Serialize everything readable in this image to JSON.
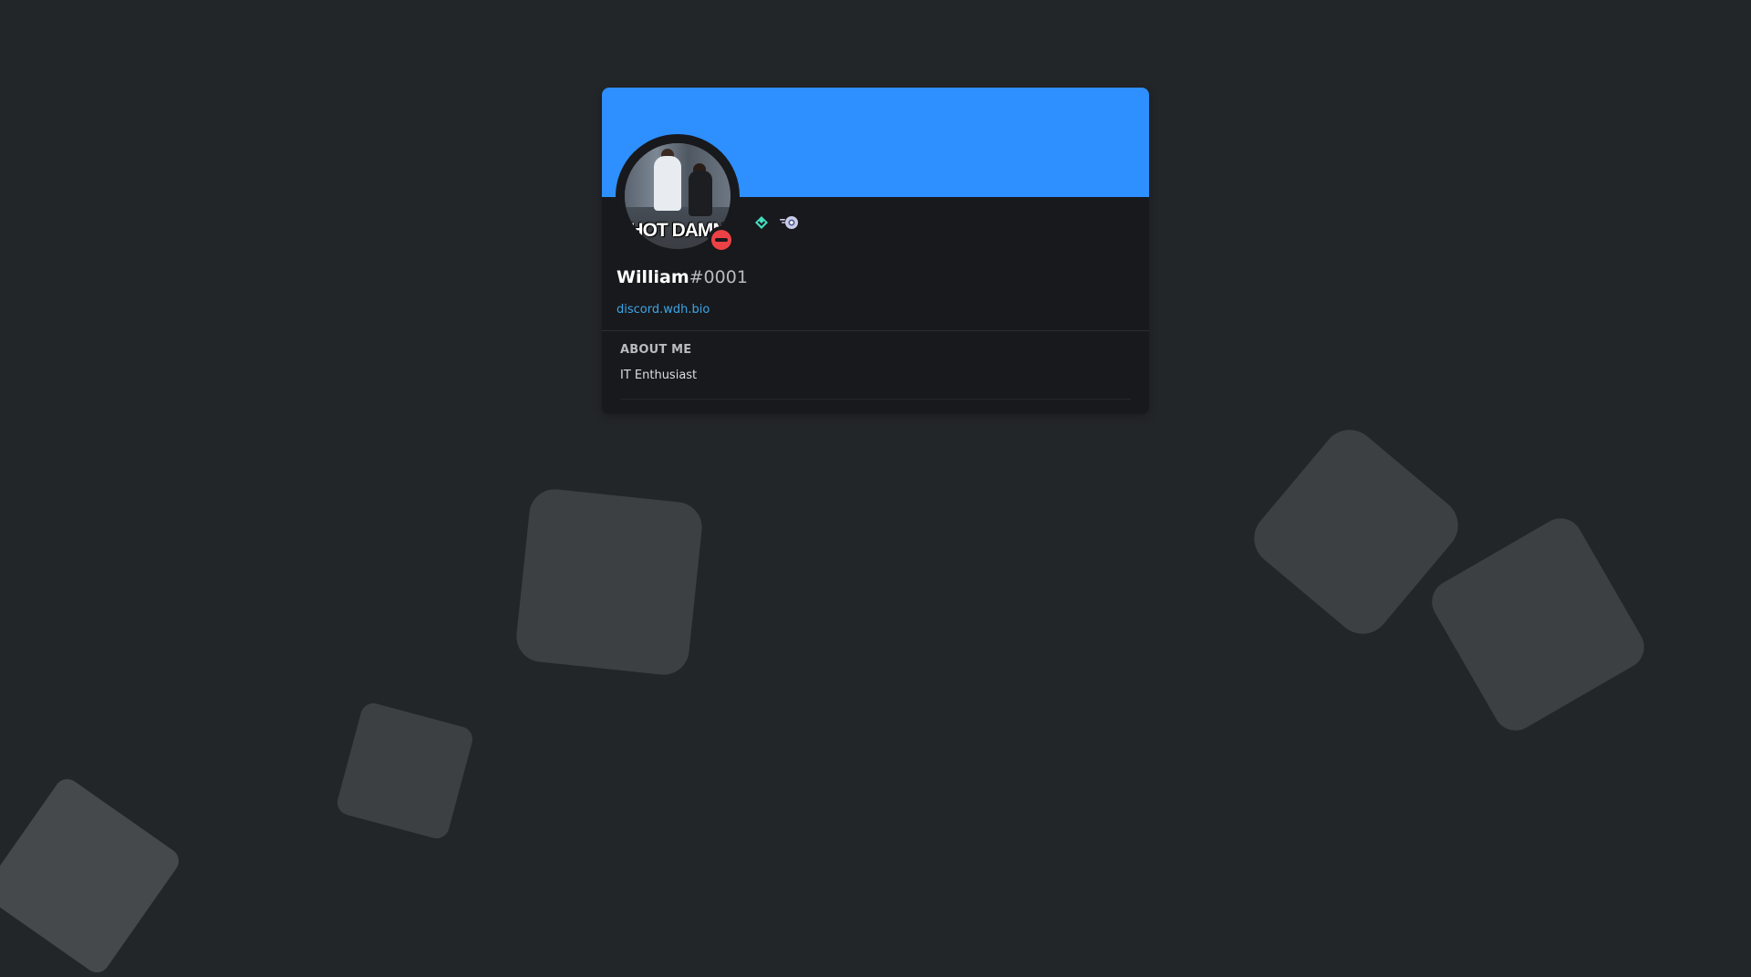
{
  "profile": {
    "username": "William",
    "discriminator": "#0001",
    "link": "discord.wdh.bio",
    "avatar_caption": "HOT DAMN",
    "status": "do-not-disturb",
    "banner_color": "#2e8ffe",
    "status_color": "#ed4245",
    "badges": [
      "hypesquad-balance-icon",
      "nitro-boost-icon"
    ],
    "about": {
      "title": "ABOUT ME",
      "text": "IT Enthusiast"
    }
  },
  "colors": {
    "background": "#232629",
    "card": "#18191c",
    "link": "#3ca6e8",
    "shapes": "#3c4043"
  }
}
